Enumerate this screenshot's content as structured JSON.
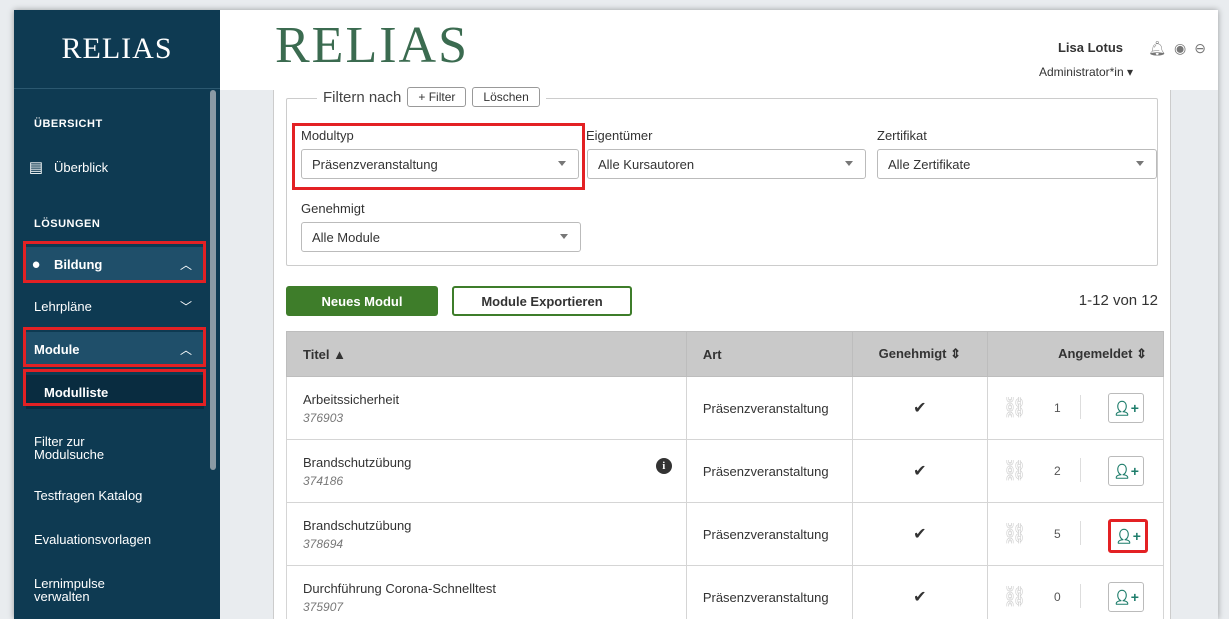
{
  "sidebar": {
    "logo": "RELIAS",
    "sections": {
      "overview": "ÜBERSICHT",
      "solutions": "LÖSUNGEN"
    },
    "items": [
      {
        "label": "Überblick"
      },
      {
        "label": "Bildung"
      },
      {
        "label": "Lehrpläne"
      },
      {
        "label": "Module"
      },
      {
        "label": "Modulliste"
      },
      {
        "label": "Filter zur Modulsuche"
      },
      {
        "label": "Testfragen Katalog"
      },
      {
        "label": "Evaluationsvorlagen"
      },
      {
        "label": "Lernimpulse verwalten"
      }
    ]
  },
  "header": {
    "brand": "RELIAS",
    "user_name": "Lisa Lotus",
    "role": "Administrator*in ▾"
  },
  "filters": {
    "legend": "Filtern nach",
    "add_filter": "+ Filter",
    "clear": "Löschen",
    "modultyp_label": "Modultyp",
    "modultyp_value": "Präsenzveranstaltung",
    "owner_label": "Eigentümer",
    "owner_value": "Alle Kursautoren",
    "cert_label": "Zertifikat",
    "cert_value": "Alle Zertifikate",
    "approved_label": "Genehmigt",
    "approved_value": "Alle Module"
  },
  "actions": {
    "new_module": "Neues Modul",
    "export": "Module Exportieren",
    "paging": "1-12 von 12"
  },
  "table": {
    "headers": {
      "title": "Titel ▲",
      "type": "Art",
      "approved": "Genehmigt ⇕",
      "registered": "Angemeldet ⇕"
    },
    "rows": [
      {
        "title": "Arbeitssicherheit",
        "id": "376903",
        "type": "Präsenzveranstaltung",
        "approved": "✔",
        "count": "1"
      },
      {
        "title": "Brandschutzübung",
        "id": "374186",
        "type": "Präsenzveranstaltung",
        "approved": "✔",
        "count": "2"
      },
      {
        "title": "Brandschutzübung",
        "id": "378694",
        "type": "Präsenzveranstaltung",
        "approved": "✔",
        "count": "5"
      },
      {
        "title": "Durchführung Corona-Schnelltest",
        "id": "375907",
        "type": "Präsenzveranstaltung",
        "approved": "✔",
        "count": "0"
      }
    ]
  },
  "colors": {
    "sidebar": "#0e3a52",
    "primary_green": "#3e7d2a",
    "highlight_red": "#e32124"
  }
}
